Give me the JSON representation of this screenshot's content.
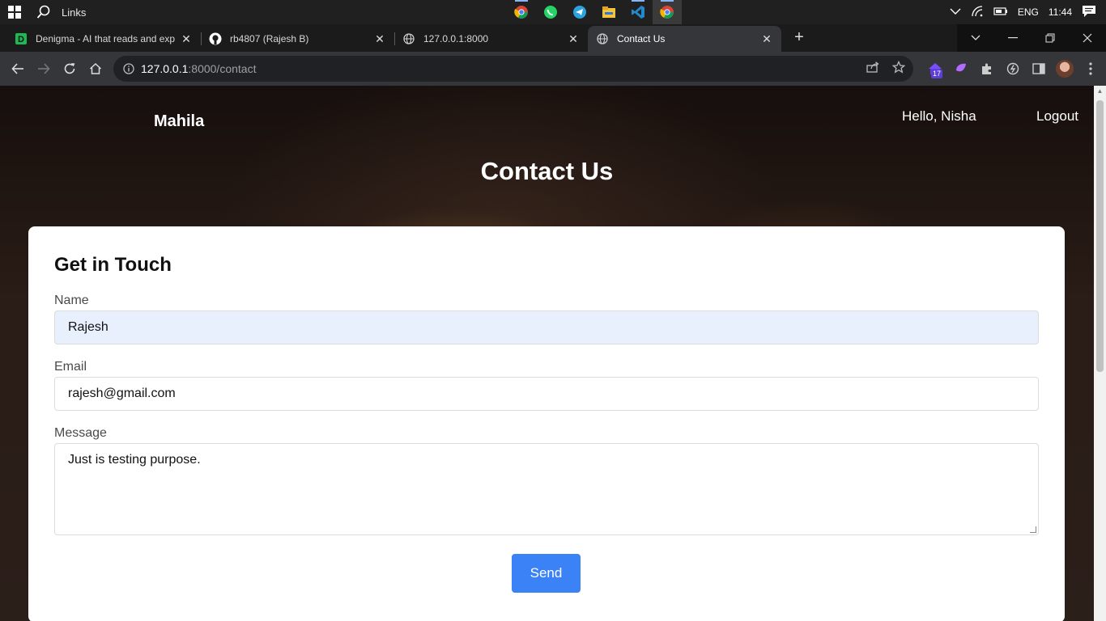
{
  "taskbar": {
    "links_label": "Links",
    "tray": {
      "language": "ENG",
      "time": "11:44"
    }
  },
  "tabs": [
    {
      "title": "Denigma - AI that reads and exp",
      "favicon": "denigma-icon"
    },
    {
      "title": "rb4807 (Rajesh B)",
      "favicon": "github-icon"
    },
    {
      "title": "127.0.0.1:8000",
      "favicon": "globe-icon"
    },
    {
      "title": "Contact Us",
      "favicon": "globe-icon",
      "active": true
    }
  ],
  "address_bar": {
    "host": "127.0.0.1",
    "path": ":8000/contact"
  },
  "extensions": {
    "badge_count": "17"
  },
  "site": {
    "brand": "Mahila",
    "greeting": "Hello, Nisha",
    "logout": "Logout",
    "page_title": "Contact Us"
  },
  "form": {
    "heading": "Get in Touch",
    "name_label": "Name",
    "name_value": "Rajesh",
    "email_label": "Email",
    "email_value": "rajesh@gmail.com",
    "message_label": "Message",
    "message_value": "Just is testing purpose.",
    "send_label": "Send"
  },
  "colors": {
    "send_button": "#3b82f6",
    "autofill": "#e8f0fe"
  }
}
